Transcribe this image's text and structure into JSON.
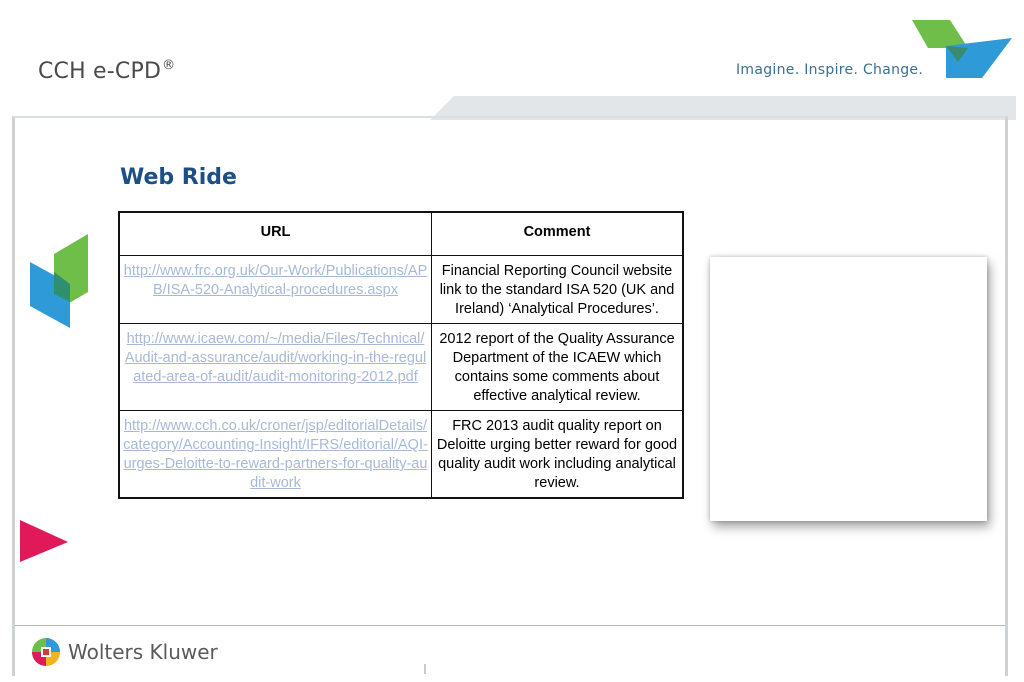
{
  "header": {
    "brand": "CCH e-CPD",
    "brand_mark": "®",
    "tagline": "Imagine. Inspire. Change."
  },
  "slide": {
    "title": "Web Ride",
    "table": {
      "headers": [
        "URL",
        "Comment"
      ],
      "rows": [
        {
          "url": "http://www.frc.org.uk/Our-Work/Publications/APB/ISA-520-Analytical-procedures.aspx",
          "comment": "Financial Reporting Council website link to the standard ISA 520 (UK and Ireland) ‘Analytical Procedures’."
        },
        {
          "url": "http://www.icaew.com/~/media/Files/Technical/Audit-and-assurance/audit/working-in-the-regulated-area-of-audit/audit-monitoring-2012.pdf",
          "comment": "2012 report of the Quality Assurance Department of the ICAEW which contains some comments about effective analytical review."
        },
        {
          "url": "http://www.cch.co.uk/croner/jsp/editorialDetails/category/Accounting-Insight/IFRS/editorial/AQI-urges-Deloitte-to-reward-partners-for-quality-audit-work",
          "comment": "FRC 2013 audit quality report on Deloitte urging better reward for good quality audit work including analytical review."
        }
      ]
    }
  },
  "footer": {
    "company": "Wolters Kluwer",
    "logo_icon": "globe-logo-icon"
  },
  "colors": {
    "title": "#1c4f86",
    "link": "#a7b9d6",
    "green": "#6fbe4a",
    "blue": "#2f9ad8",
    "pink": "#e0195a",
    "footer_line": "#8ec5d6"
  }
}
